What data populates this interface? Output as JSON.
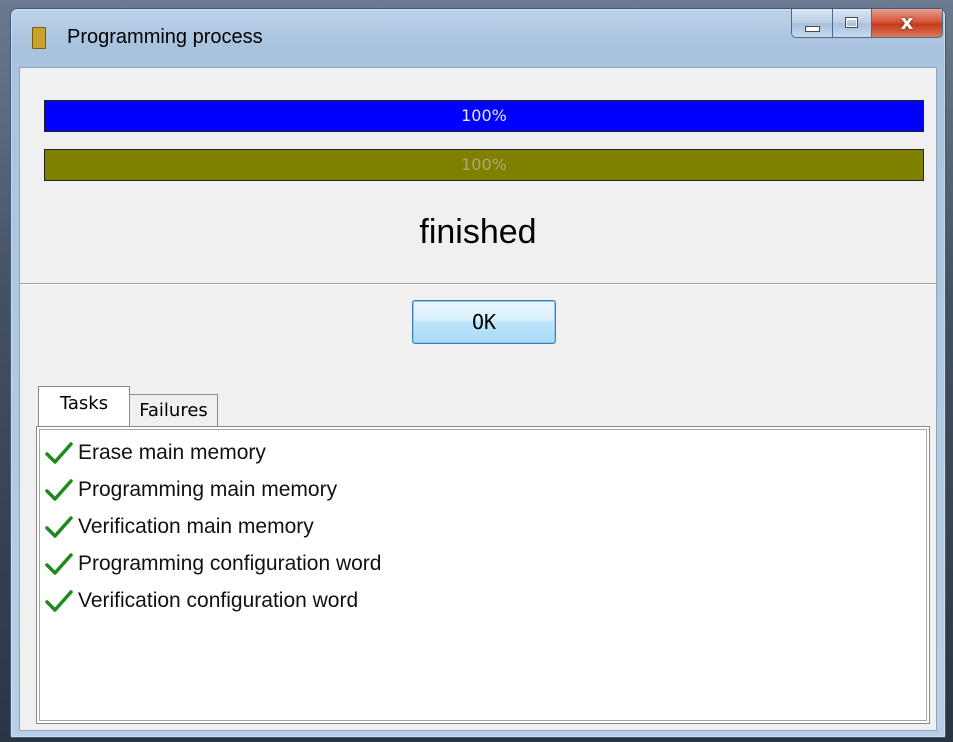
{
  "window": {
    "title": "Programming process",
    "close_glyph": "x"
  },
  "progress": {
    "bar1": {
      "value": 1.0,
      "label": "100%",
      "color": "#0000ff"
    },
    "bar2": {
      "value": 1.0,
      "label": "100%",
      "color": "#808000"
    }
  },
  "status": {
    "text": "finished"
  },
  "buttons": {
    "ok_label": "OK"
  },
  "tabs": [
    {
      "label": "Tasks",
      "selected": true
    },
    {
      "label": "Failures",
      "selected": false
    }
  ],
  "tasks": [
    {
      "label": "Erase main memory",
      "icon": "check-icon"
    },
    {
      "label": "Programming main memory",
      "icon": "check-icon"
    },
    {
      "label": "Verification main memory",
      "icon": "check-icon"
    },
    {
      "label": "Programming configuration word",
      "icon": "check-icon"
    },
    {
      "label": "Verification configuration word",
      "icon": "check-icon"
    }
  ],
  "colors": {
    "check": "#1e8a1e"
  }
}
